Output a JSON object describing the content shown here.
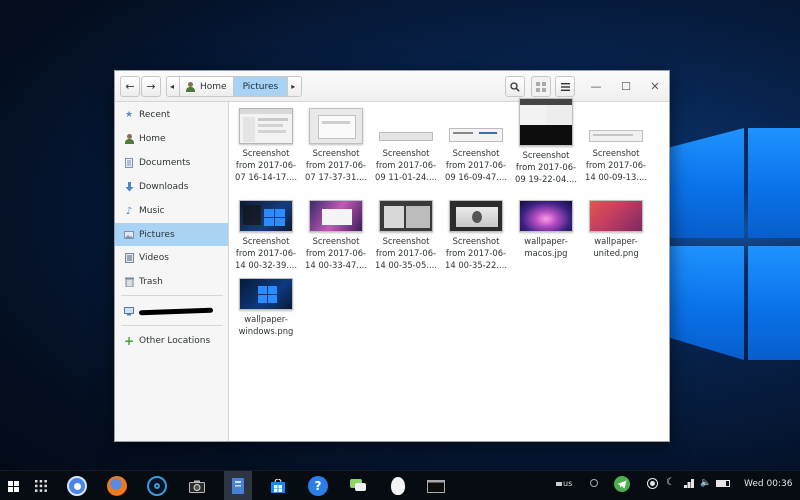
{
  "window": {
    "path": [
      {
        "label": "Home"
      },
      {
        "label": "Pictures",
        "active": true
      }
    ],
    "controls": {
      "minimize": "—",
      "maximize": "☐",
      "close": "✕"
    }
  },
  "sidebar": {
    "items": [
      {
        "label": "Recent",
        "icon": "clock-icon"
      },
      {
        "label": "Home",
        "icon": "home-icon"
      },
      {
        "label": "Documents",
        "icon": "documents-icon"
      },
      {
        "label": "Downloads",
        "icon": "downloads-icon"
      },
      {
        "label": "Music",
        "icon": "music-icon"
      },
      {
        "label": "Pictures",
        "icon": "pictures-icon",
        "active": true
      },
      {
        "label": "Videos",
        "icon": "videos-icon"
      },
      {
        "label": "Trash",
        "icon": "trash-icon"
      }
    ],
    "device_label": "",
    "other_locations": "Other Locations"
  },
  "files": [
    {
      "name": "Screenshot from 2017-06-07 16-14-17....",
      "thumb": "light"
    },
    {
      "name": "Screenshot from 2017-06-07 17-37-31....",
      "thumb": "gray"
    },
    {
      "name": "Screenshot from 2017-06-09 11-01-24....",
      "thumb": "wide"
    },
    {
      "name": "Screenshot from 2017-06-09 16-09-47....",
      "thumb": "wide2"
    },
    {
      "name": "Screenshot from 2017-06-09 19-22-04....",
      "thumb": "darktop"
    },
    {
      "name": "Screenshot from 2017-06-14 00-09-13....",
      "thumb": "wide3"
    },
    {
      "name": "Screenshot from 2017-06-14 00-32-39....",
      "thumb": "win"
    },
    {
      "name": "Screenshot from 2017-06-14 00-33-47....",
      "thumb": "mac"
    },
    {
      "name": "Screenshot from 2017-06-14 00-35-05....",
      "thumb": "darkwin"
    },
    {
      "name": "Screenshot from 2017-06-14 00-35-22....",
      "thumb": "darkwin2"
    },
    {
      "name": "wallpaper-macos.jpg",
      "thumb": "macos"
    },
    {
      "name": "wallpaper-united.png",
      "thumb": "united"
    },
    {
      "name": "wallpaper-windows.png",
      "thumb": "windows"
    }
  ],
  "taskbar": {
    "keyboard_layout": "us",
    "clock": "Wed 00:36"
  },
  "colors": {
    "selection": "#a9d3f5",
    "wallpaper_blue": "#0a72ea",
    "taskbar": "#070b12"
  }
}
